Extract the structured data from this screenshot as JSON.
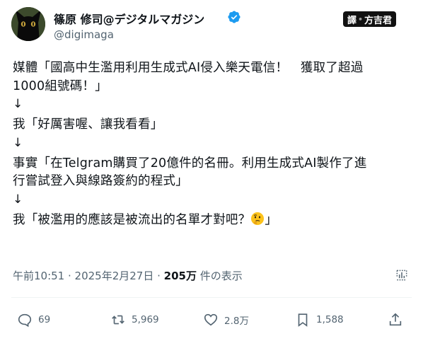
{
  "author": {
    "display_name": "篠原 修司@デジタルマガジン",
    "handle": "@digimaga",
    "verified": true
  },
  "watermark": {
    "left": "譯",
    "dot": "•",
    "right": "方吉君"
  },
  "tweet": {
    "lines": [
      "媒體「國高中生濫用利用生成式AI侵入樂天電信！　獲取了超過",
      "1000組號碼！」",
      "↓",
      "我「好厲害喔、讓我看看」",
      "↓",
      "事實「在Telgram購買了20億件的名冊。利用生成式AI製作了進",
      "行嘗試登入與線路簽約的程式」",
      "↓",
      "我「被濫用的應該是被流出的名單才對吧？",
      "」"
    ]
  },
  "meta": {
    "time": "午前10:51",
    "separator": " · ",
    "date": "2025年2月27日",
    "views_count": "205万",
    "views_label": " 件の表示"
  },
  "actions": {
    "replies": "69",
    "reposts": "5,969",
    "likes": "2.8万",
    "bookmarks": "1,588"
  },
  "icons": {
    "verified": "verified-badge-icon",
    "analytics": "analytics-icon",
    "reply": "reply-icon",
    "repost": "repost-icon",
    "like": "heart-icon",
    "bookmark": "bookmark-icon",
    "share": "share-icon",
    "emoji": "thinking-face-emoji"
  },
  "colors": {
    "verified_blue": "#1d9bf0",
    "secondary_text": "#536471",
    "primary_text": "#0f1419"
  }
}
